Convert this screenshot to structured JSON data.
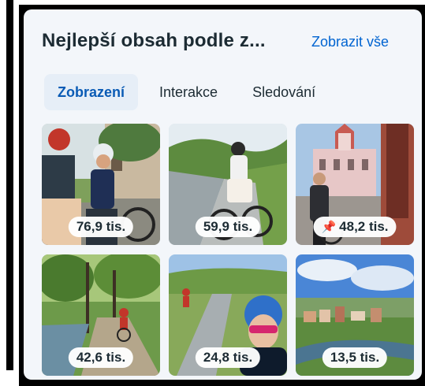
{
  "header": {
    "title": "Nejlepší obsah podle z...",
    "see_all": "Zobrazit vše"
  },
  "tabs": [
    {
      "label": "Zobrazení",
      "active": true
    },
    {
      "label": "Interakce",
      "active": false
    },
    {
      "label": "Sledování",
      "active": false
    }
  ],
  "posts": [
    {
      "views": "76,9 tis.",
      "scene": "cyclists by castle"
    },
    {
      "views": "59,9 tis.",
      "scene": "cyclist on river path"
    },
    {
      "views": "48,2 tis.",
      "scene": "cyclist at church",
      "pinned": true
    },
    {
      "views": "42,6 tis.",
      "scene": "cyclist in forest"
    },
    {
      "views": "24,8 tis.",
      "scene": "cyclist selfie"
    },
    {
      "views": "13,5 tis.",
      "scene": "town aerial view"
    }
  ],
  "colors": {
    "accent": "#0064d1",
    "active_tab_bg": "#e6eef7",
    "card_bg": "#f3f6fa"
  }
}
